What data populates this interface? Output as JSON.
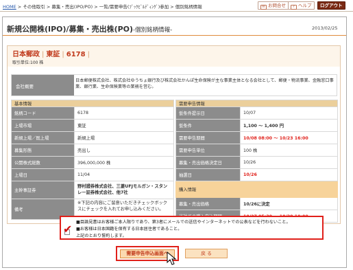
{
  "header": {
    "breadcrumb_home": "HOME",
    "breadcrumb_rest": " > その他取引 > 募集・売出(IPO/PO) > 一覧/需要申告(ﾌﾞｯｸﾋﾞﾙﾃﾞｨﾝｸﾞ)参加 > 個別銘柄情報",
    "buttons": {
      "inquiry": "お問合せ",
      "help": "ヘルプ",
      "logout": "ログアウト"
    }
  },
  "page": {
    "title": "新規公開株(IPO)/募集・売出株(PO)",
    "subtitle": "-個別銘柄情報-",
    "date": "2013/02/25"
  },
  "stock": {
    "name": "日本郵政",
    "market": "東証",
    "code": "6178",
    "unit": "取引単位:100 株"
  },
  "overview": {
    "label": "会社概要",
    "text": "日本郵便株式会社、株式会社ゆうちょ銀行及び株式会社かんぽ生命保険が主な事業主体となる会社として、郵便・物流事業、金融窓口事業、銀行業、生命保険業等の業務を営む。"
  },
  "basic": {
    "header": "基本情報",
    "rows": [
      {
        "k": "銘柄コード",
        "v": "6178"
      },
      {
        "k": "上場市場",
        "v": "東証"
      },
      {
        "k": "新規上場／既上場",
        "v": "新規上場"
      },
      {
        "k": "募集形態",
        "v": "売出し"
      },
      {
        "k": "公開株式総数",
        "v": "396,000,000 株"
      },
      {
        "k": "上場日",
        "v": "11/04"
      },
      {
        "k": "主幹事証券",
        "v": "野村證券株式会社、三菱UFJモルガン・スタンレー証券株式会社、他7社"
      },
      {
        "k": "備考",
        "v": "※下記の内容にご留意いただきチェックボックスにチェックを入れてお申し込みください。"
      }
    ]
  },
  "demand": {
    "header": "需要申告情報",
    "rows": [
      {
        "k": "仮条件提示日",
        "v": "10/07"
      },
      {
        "k": "仮条件",
        "v": "1,100 〜 1,400 円"
      },
      {
        "k": "需要申告期間",
        "v": "10/08 08:00 〜 10/23 16:00"
      },
      {
        "k": "需要申告単位",
        "v": "100 株"
      },
      {
        "k": "募集・売出価格決定日",
        "v": "10/26"
      },
      {
        "k": "抽選日",
        "v": "10/26"
      }
    ],
    "purchase_header": "購入情報",
    "purchase_rows": [
      {
        "k": "募集・売出価格",
        "v": "10/26に決定"
      },
      {
        "k": "当社での購入申込期間",
        "v": "10/27 05:30 〜 10/30 10:00"
      }
    ]
  },
  "agreement": {
    "line1": "■目論見書はお客様ご本人限りであり、第3者にメールでの送信やインターネットでの公表などを行わないこと。",
    "line2": "■お客様は日本国籍を保有する日本居住者であること。",
    "line3": "上記のとおり誓約します。",
    "checked": true
  },
  "actions": {
    "apply": "需要申告申込画面へ",
    "back": "戻 る"
  },
  "colors": {
    "accent": "#e0201a",
    "brand": "#c0391b",
    "label_bg": "#8c8c8c",
    "header_bg": "#ebcf9b"
  }
}
